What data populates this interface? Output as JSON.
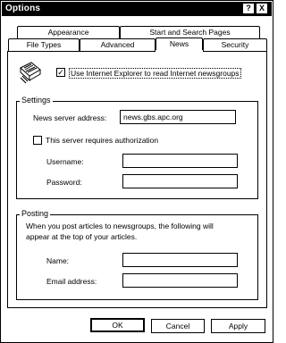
{
  "window": {
    "title": "Options",
    "help_glyph": "?",
    "close_glyph": "X"
  },
  "tabs": {
    "row1": [
      "Appearance",
      "Start and Search Pages"
    ],
    "row2": [
      "File Types",
      "Advanced",
      "News",
      "Security"
    ],
    "active": "News"
  },
  "news": {
    "use_ie_label": "Use Internet Explorer to read Internet newsgroups",
    "use_ie_checked": "✓",
    "icon": "newspaper-icon",
    "settings": {
      "legend": "Settings",
      "server_label": "News server address:",
      "server_value": "news.gbs.apc.org",
      "auth_label": "This server requires authorization",
      "auth_checked": "",
      "username_label": "Username:",
      "username_value": "",
      "password_label": "Password:",
      "password_value": ""
    },
    "posting": {
      "legend": "Posting",
      "description_line1": "When you post articles to newsgroups, the following will",
      "description_line2": "appear at the top of your articles.",
      "name_label": "Name:",
      "name_value": "",
      "email_label": "Email address:",
      "email_value": ""
    }
  },
  "buttons": {
    "ok": "OK",
    "cancel": "Cancel",
    "apply": "Apply"
  }
}
